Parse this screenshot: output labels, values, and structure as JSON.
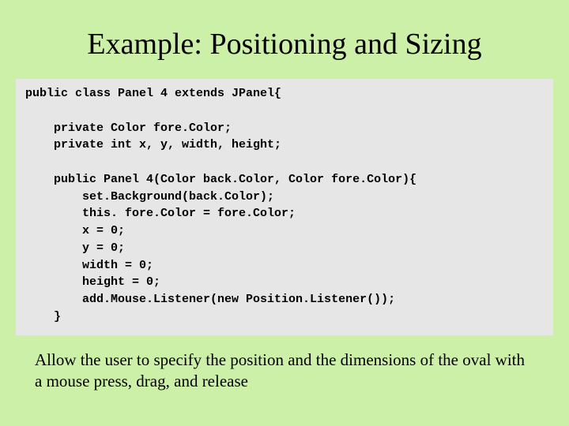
{
  "title": "Example: Positioning and Sizing",
  "code": {
    "l1": "public class Panel 4 extends JPanel{",
    "l2": "",
    "l3": "    private Color fore.Color;",
    "l4": "    private int x, y, width, height;",
    "l5": "",
    "l6": "    public Panel 4(Color back.Color, Color fore.Color){",
    "l7": "        set.Background(back.Color);",
    "l8": "        this. fore.Color = fore.Color;",
    "l9": "        x = 0;",
    "l10": "        y = 0;",
    "l11": "        width = 0;",
    "l12": "        height = 0;",
    "l13": "        add.Mouse.Listener(new Position.Listener());",
    "l14": "    }"
  },
  "caption": "Allow the user to specify the position and the dimensions of the oval with a mouse press, drag, and release"
}
